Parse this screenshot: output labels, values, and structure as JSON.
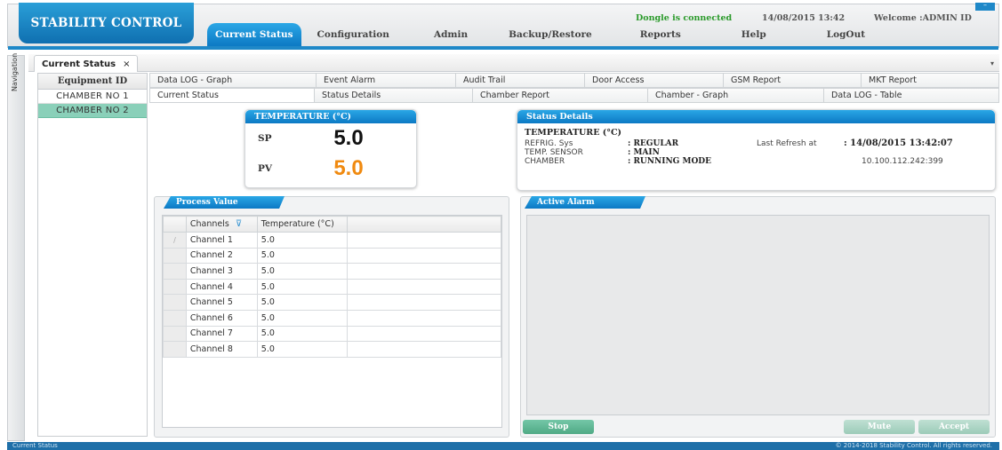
{
  "app": {
    "title": "STABILITY CONTROL",
    "dongle_status": "Dongle is connected",
    "datetime": "14/08/2015 13:42",
    "welcome": "Welcome :ADMIN ID",
    "minimize": "–"
  },
  "topnav": {
    "items": [
      "Current Status",
      "Configuration",
      "Admin",
      "Backup/Restore",
      "Reports",
      "Help",
      "LogOut"
    ]
  },
  "navigation_strip": {
    "label": "Navigation"
  },
  "doc_tab": {
    "label": "Current Status",
    "close": "×",
    "dropdown": "▾"
  },
  "equipment": {
    "header": "Equipment ID",
    "items": [
      "CHAMBER NO 1",
      "CHAMBER NO 2"
    ],
    "selected_index": 1
  },
  "subtabs": {
    "row1": [
      "Data LOG - Graph",
      "Event Alarm",
      "Audit Trail",
      "Door Access",
      "GSM Report",
      "MKT Report"
    ],
    "row2": [
      "Current Status",
      "Status Details",
      "Chamber Report",
      "Chamber - Graph",
      "Data LOG - Table"
    ]
  },
  "temperature": {
    "title": "TEMPERATURE (°C)",
    "sp_label": "SP",
    "sp_value": "5.0",
    "pv_label": "PV",
    "pv_value": "5.0"
  },
  "status_details": {
    "title": "Status Details",
    "section": "TEMPERATURE (°C)",
    "rows": [
      {
        "key": "REFRIG. Sys",
        "value": ": REGULAR"
      },
      {
        "key": "TEMP. SENSOR",
        "value": ": MAIN"
      },
      {
        "key": "CHAMBER",
        "value": ": RUNNING MODE"
      }
    ],
    "last_refresh_label": "Last Refresh at",
    "last_refresh_value": ": 14/08/2015 13:42:07",
    "ip": "10.100.112.242:399"
  },
  "process_value": {
    "title": "Process Value",
    "columns": [
      "Channels",
      "Temperature (°C)"
    ],
    "filter_icon": "⊽",
    "row_indicator": "∕",
    "rows": [
      {
        "channel": "Channel 1",
        "temp": "5.0"
      },
      {
        "channel": "Channel 2",
        "temp": "5.0"
      },
      {
        "channel": "Channel 3",
        "temp": "5.0"
      },
      {
        "channel": "Channel 4",
        "temp": "5.0"
      },
      {
        "channel": "Channel 5",
        "temp": "5.0"
      },
      {
        "channel": "Channel 6",
        "temp": "5.0"
      },
      {
        "channel": "Channel 7",
        "temp": "5.0"
      },
      {
        "channel": "Channel 8",
        "temp": "5.0"
      }
    ]
  },
  "active_alarm": {
    "title": "Active Alarm",
    "stop": "Stop",
    "mute": "Mute",
    "accept": "Accept"
  },
  "footer": {
    "left": "Current Status",
    "right": "© 2014-2018 Stability Control. All rights reserved."
  },
  "colors": {
    "accent": "#1e88c8",
    "selected_row": "#8ad0b9",
    "pv_value": "#f08a10",
    "dongle": "#2a9a2a"
  }
}
